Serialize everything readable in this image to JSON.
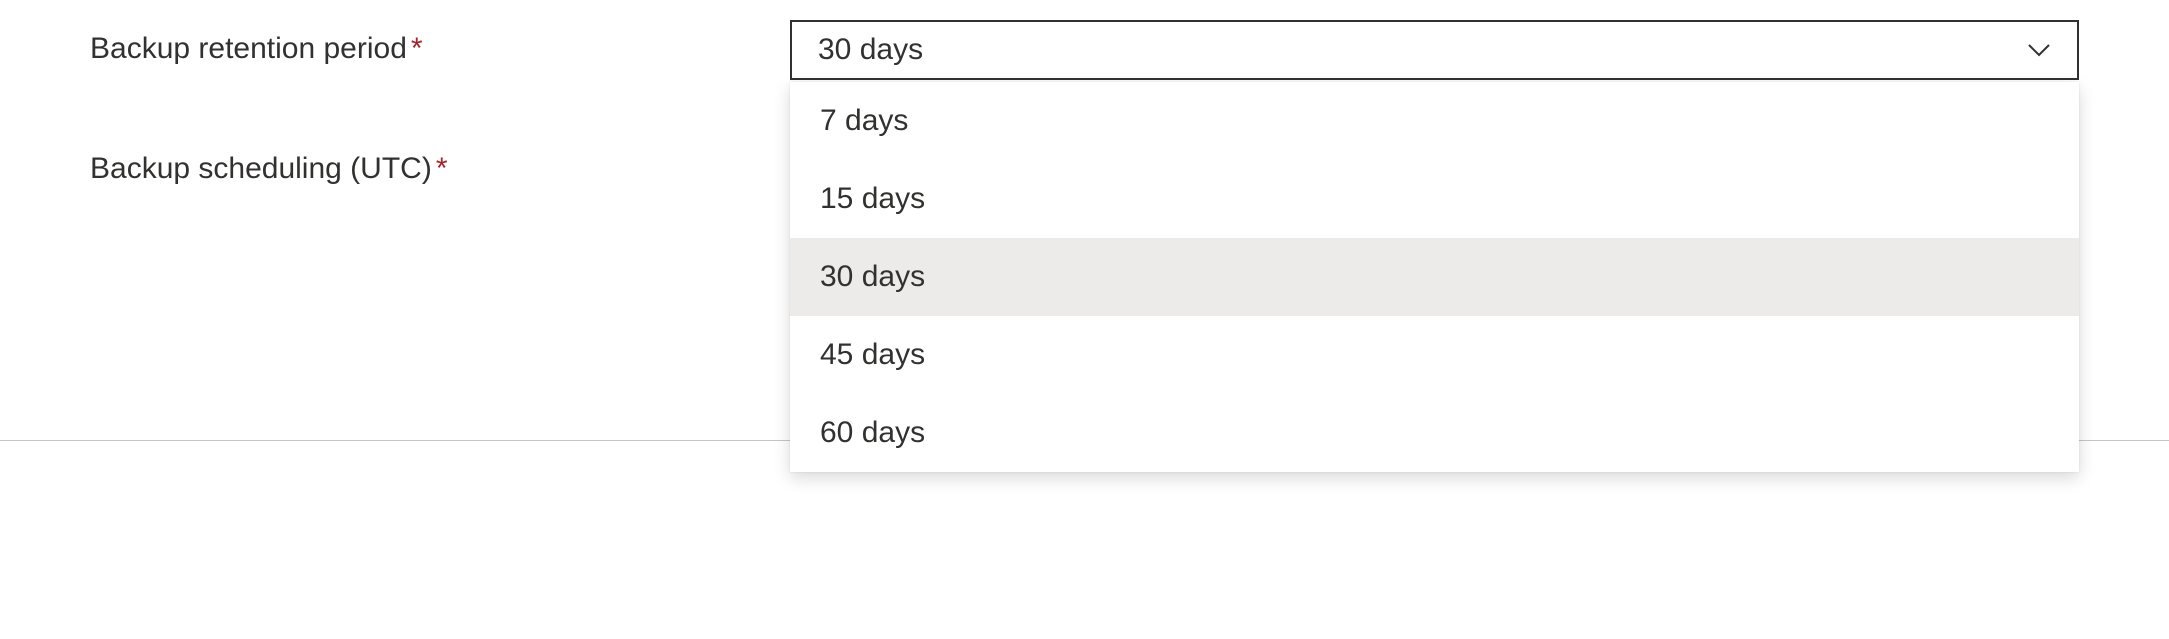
{
  "fields": {
    "retention": {
      "label": "Backup retention period",
      "required_marker": "*",
      "selected_value": "30 days",
      "options": [
        "7 days",
        "15 days",
        "30 days",
        "45 days",
        "60 days"
      ],
      "selected_index": 2
    },
    "scheduling": {
      "label": "Backup scheduling (UTC)",
      "required_marker": "*"
    }
  }
}
